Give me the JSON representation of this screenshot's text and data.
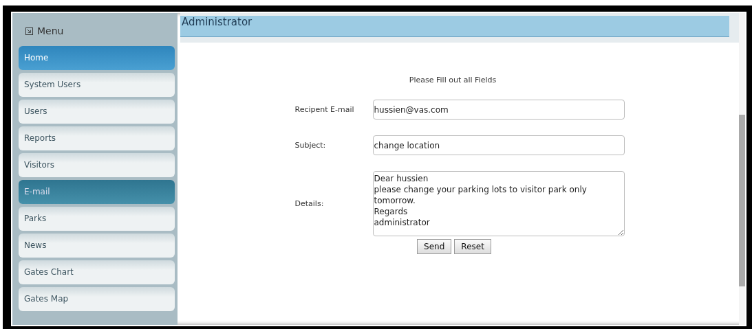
{
  "sidebar": {
    "title": "Menu",
    "items": [
      {
        "label": "Home",
        "selected": true,
        "hovered": false
      },
      {
        "label": "System Users",
        "selected": false,
        "hovered": false
      },
      {
        "label": "Users",
        "selected": false,
        "hovered": false
      },
      {
        "label": "Reports",
        "selected": false,
        "hovered": false
      },
      {
        "label": "Visitors",
        "selected": false,
        "hovered": false
      },
      {
        "label": "E-mail",
        "selected": false,
        "hovered": true
      },
      {
        "label": "Parks",
        "selected": false,
        "hovered": false
      },
      {
        "label": "News",
        "selected": false,
        "hovered": false
      },
      {
        "label": "Gates Chart",
        "selected": false,
        "hovered": false
      },
      {
        "label": "Gates Map",
        "selected": false,
        "hovered": false
      }
    ]
  },
  "header": {
    "title": "Administrator"
  },
  "form": {
    "instruction": "Please Fill out all Fields",
    "fields": [
      {
        "kind": "input",
        "label": "Recipent E-mail",
        "value": "hussien@vas.com"
      },
      {
        "kind": "input",
        "label": "Subject:",
        "value": "change location"
      },
      {
        "kind": "textarea",
        "label": "Details:",
        "value": "Dear hussien\nplease change your parking lots to visitor park only tomorrow.\nRegards\nadministrator"
      }
    ],
    "buttons": [
      "Send",
      "Reset"
    ]
  }
}
